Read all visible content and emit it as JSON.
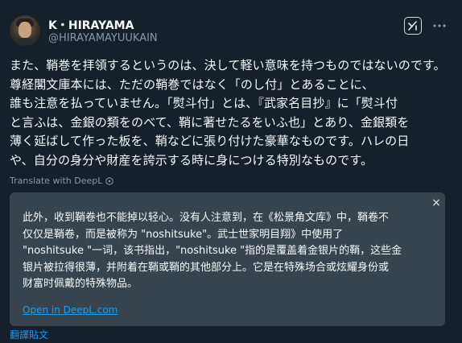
{
  "author": {
    "name": "K・HIRAYAMA",
    "handle": "@HIRAYAMAYUUKAIN"
  },
  "tweet": {
    "text": "また、鞘巻を拝領するというのは、決して軽い意味を持つものではないのです。尊経閣文庫本には、ただの鞘巻ではなく「のし付」とあることに、\n誰も注意を払っていません。「熨斗付」とは、『武家名目抄』に「熨斗付\nと言ふは、金銀の類をのべて、鞘に著せたるをいふ也」とあり、金銀類を\n薄く延ばして作った板を、鞘などに張り付けた豪華なものです。ハレの日\nや、自分の身分や財産を誇示する時に身につける特別なものです。"
  },
  "translate_link": "Translate with DeepL",
  "translation_card": {
    "text": "此外，收到鞘卷也不能掉以轻心。没有人注意到，在《松景角文库》中，鞘卷不\n仅仅是鞘卷，而是被称为 \"noshitsuke\"。武士世家明目翔》中使用了\n\"noshitsuke \"一词，该书指出，\"noshitsuke \"指的是覆盖着金银片的鞘，这些金\n银片被拉得很薄，并附着在鞘或鞘的其他部分上。它是在特殊场合或炫耀身份或\n财富时佩戴的特殊物品。",
    "open_link": "Open in DeepL.com",
    "close_glyph": "×"
  },
  "footer_link": "翻譯貼文",
  "icons": {
    "grok": "grok-icon",
    "more": "more-icon",
    "deepl": "deepl-icon",
    "close": "close-icon"
  },
  "colors": {
    "background": "#15202b",
    "card": "#38444d",
    "link": "#1d9bf0",
    "muted": "#8b98a5",
    "text": "#f7f9f9"
  }
}
